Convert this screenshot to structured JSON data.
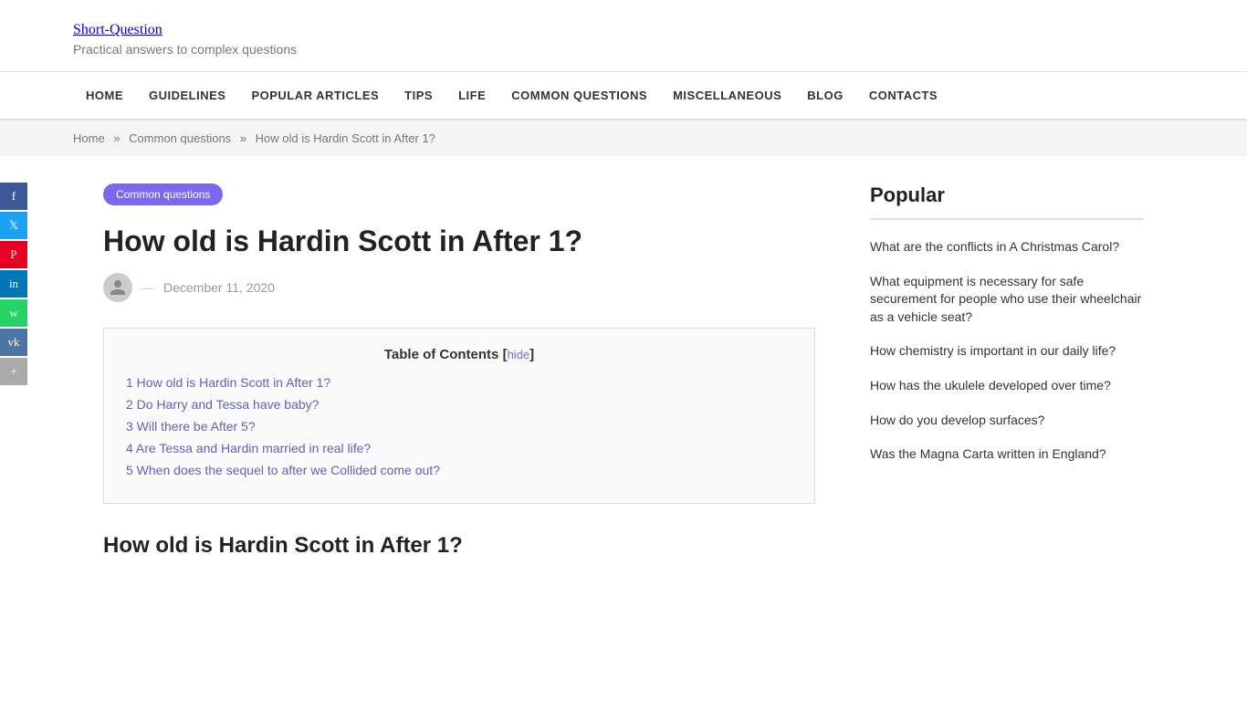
{
  "site": {
    "title": "Short-Question",
    "tagline": "Practical answers to complex questions"
  },
  "nav": {
    "items": [
      {
        "label": "HOME",
        "href": "#"
      },
      {
        "label": "GUIDELINES",
        "href": "#"
      },
      {
        "label": "POPULAR ARTICLES",
        "href": "#"
      },
      {
        "label": "TIPS",
        "href": "#"
      },
      {
        "label": "LIFE",
        "href": "#"
      },
      {
        "label": "COMMON QUESTIONS",
        "href": "#"
      },
      {
        "label": "MISCELLANEOUS",
        "href": "#"
      },
      {
        "label": "BLOG",
        "href": "#"
      },
      {
        "label": "CONTACTS",
        "href": "#"
      }
    ]
  },
  "breadcrumb": {
    "items": [
      {
        "label": "Home",
        "href": "#"
      },
      {
        "label": "Common questions",
        "href": "#"
      },
      {
        "label": "How old is Hardin Scott in After 1?",
        "href": "#"
      }
    ]
  },
  "social": {
    "buttons": [
      {
        "label": "f",
        "class": "social-fb"
      },
      {
        "label": "t",
        "class": "social-tw"
      },
      {
        "label": "P",
        "class": "social-pi"
      },
      {
        "label": "in",
        "class": "social-li"
      },
      {
        "label": "w",
        "class": "social-wa"
      },
      {
        "label": "vk",
        "class": "social-vk"
      },
      {
        "label": "+",
        "class": "social-share"
      }
    ]
  },
  "article": {
    "category": "Common questions",
    "title": "How old is Hardin Scott in After 1?",
    "date": "December 11, 2020",
    "toc_title": "Table of Contents",
    "toc_hide": "hide",
    "toc_items": [
      {
        "number": "1",
        "label": "How old is Hardin Scott in After 1?",
        "href": "#"
      },
      {
        "number": "2",
        "label": "Do Harry and Tessa have baby?",
        "href": "#"
      },
      {
        "number": "3",
        "label": "Will there be After 5?",
        "href": "#"
      },
      {
        "number": "4",
        "label": "Are Tessa and Hardin married in real life?",
        "href": "#"
      },
      {
        "number": "5",
        "label": "When does the sequel to after we Collided come out?",
        "href": "#"
      }
    ],
    "section_title": "How old is Hardin Scott in After 1?"
  },
  "sidebar": {
    "title": "Popular",
    "links": [
      {
        "label": "What are the conflicts in A Christmas Carol?"
      },
      {
        "label": "What equipment is necessary for safe securement for people who use their wheelchair as a vehicle seat?"
      },
      {
        "label": "How chemistry is important in our daily life?"
      },
      {
        "label": "How has the ukulele developed over time?"
      },
      {
        "label": "How do you develop surfaces?"
      },
      {
        "label": "Was the Magna Carta written in England?"
      }
    ]
  }
}
